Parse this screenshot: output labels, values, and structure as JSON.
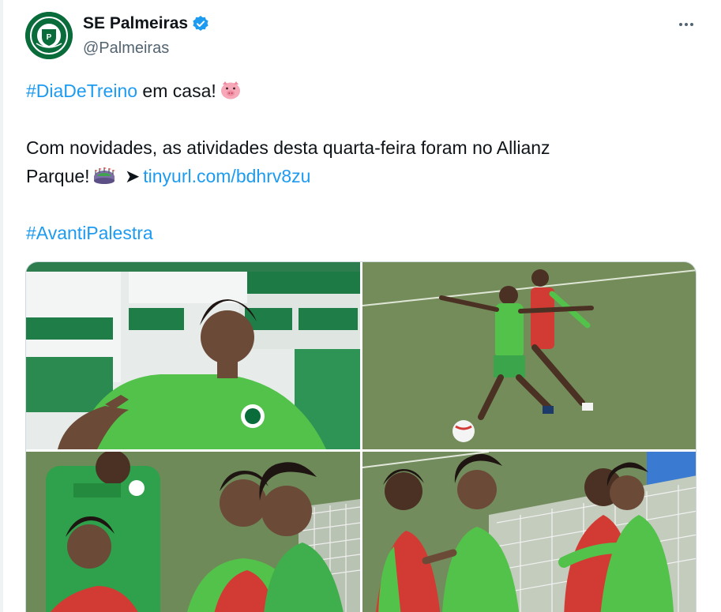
{
  "author": {
    "display_name": "SE Palmeiras",
    "handle": "@Palmeiras",
    "verified": true,
    "avatar_icon": "palmeiras-crest"
  },
  "more_icon": "more-horizontal-icon",
  "tweet": {
    "line1": {
      "hashtag": "#DiaDeTreino",
      "text": " em casa!",
      "emoji": "pig-face"
    },
    "line2": {
      "text": "Com novidades, as atividades desta quarta-feira foram no Allianz"
    },
    "line3": {
      "text": "Parque!",
      "emoji": "stadium",
      "arrow": "➤",
      "link": "tinyurl.com/bdhrv8zu"
    },
    "line4": {
      "hashtag": "#AvantiPalestra"
    }
  },
  "media": {
    "count": 4,
    "photos": [
      {
        "description_icon": "photo-player-bench"
      },
      {
        "description_icon": "photo-players-ball"
      },
      {
        "description_icon": "photo-players-laughing"
      },
      {
        "description_icon": "photo-players-hug"
      }
    ]
  },
  "colors": {
    "link": "#1d9bf0",
    "text": "#0f1419",
    "secondary": "#536471",
    "verified": "#1d9bf0",
    "brand_green": "#0a6b3b"
  }
}
